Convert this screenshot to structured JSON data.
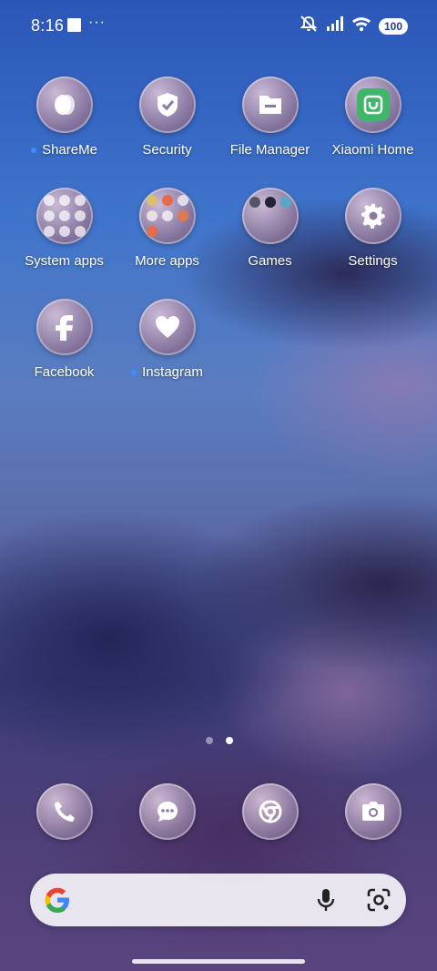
{
  "status": {
    "time": "8:16",
    "overflow": "···",
    "battery": "100",
    "icons": [
      "notification-square-icon",
      "silent-mode-icon",
      "signal-icon",
      "wifi-icon",
      "battery-icon"
    ]
  },
  "apps": [
    {
      "label": "ShareMe",
      "icon": "shareme-icon",
      "new": true
    },
    {
      "label": "Security",
      "icon": "shield-check-icon",
      "new": false
    },
    {
      "label": "File Manager",
      "icon": "folder-icon",
      "new": false
    },
    {
      "label": "Xiaomi Home",
      "icon": "xiaomi-home-icon",
      "new": false
    },
    {
      "label": "System apps",
      "icon": "folder-icon",
      "new": false
    },
    {
      "label": "More apps",
      "icon": "folder-icon",
      "new": false
    },
    {
      "label": "Games",
      "icon": "folder-icon",
      "new": false
    },
    {
      "label": "Settings",
      "icon": "gear-icon",
      "new": false
    },
    {
      "label": "Facebook",
      "icon": "facebook-icon",
      "new": false
    },
    {
      "label": "Instagram",
      "icon": "heart-icon",
      "new": true
    }
  ],
  "pager": {
    "pages": 2,
    "active": 2
  },
  "dock": [
    "phone-icon",
    "messages-icon",
    "chrome-icon",
    "camera-icon"
  ],
  "search": {
    "logo": "google-logo",
    "voice": "microphone-icon",
    "lens": "lens-camera-icon"
  },
  "colors": {
    "accent": "#3e8bff",
    "xiaomi_green": "#3fb66a"
  }
}
